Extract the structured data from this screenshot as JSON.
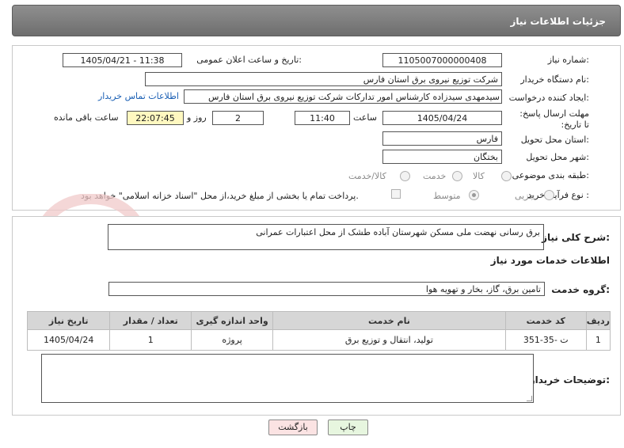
{
  "header": {
    "title": "جزئیات اطلاعات نیاز"
  },
  "form": {
    "need_number_label": "شماره نیاز:",
    "need_number": "1105007000000408",
    "announce_label": "تاریخ و ساعت اعلان عمومی:",
    "announce_value": "1405/04/21 - 11:38",
    "buyer_org_label": "نام دستگاه خریدار:",
    "buyer_org": "شرکت توزیع نیروی برق استان فارس",
    "creator_label": "ایجاد کننده درخواست:",
    "creator": "سیدمهدی سیدزاده کارشناس امور تدارکات شرکت توزیع نیروی برق استان فارس",
    "contact_link": "اطلاعات تماس خریدار",
    "deadline_label": "مهلت ارسال پاسخ: تا تاریخ:",
    "deadline_date": "1405/04/24",
    "time_label": "ساعت",
    "deadline_time": "11:40",
    "days_value": "2",
    "days_label": "روز و",
    "remaining_value": "22:07:45",
    "remaining_label": "ساعت باقی مانده",
    "province_label": "استان محل تحویل:",
    "province": "فارس",
    "city_label": "شهر محل تحویل:",
    "city": "بختگان",
    "category_label": "طبقه بندی موضوعی:",
    "category_options": {
      "goods": "کالا",
      "service": "خدمت",
      "goods_service": "کالا/خدمت"
    },
    "process_label": "نوع فرآیند خرید :",
    "process_options": {
      "partial": "جزیی",
      "medium": "متوسط"
    },
    "payment_note": "پرداخت تمام یا بخشی از مبلغ خرید،از محل \"اسناد خزانه اسلامی\" خواهد بود."
  },
  "details": {
    "general_desc_label": "شرح کلی نیاز:",
    "general_desc": "برق رسانی نهضت ملی مسکن شهرستان آباده طشک از محل اعتبارات عمرانی",
    "services_info_title": "اطلاعات خدمات مورد نیاز",
    "service_group_label": "گروه خدمت:",
    "service_group": "تامین برق، گاز، بخار و تهویه هوا",
    "table": {
      "headers": [
        "ردیف",
        "کد خدمت",
        "نام خدمت",
        "واحد اندازه گیری",
        "تعداد / مقدار",
        "تاریخ نیاز"
      ],
      "rows": [
        [
          "1",
          "ت -35-351",
          "تولید، انتقال و توزیع برق",
          "پروژه",
          "1",
          "1405/04/24"
        ]
      ]
    },
    "buyer_notes_label": "توضیحات خریدار:",
    "buyer_notes": ""
  },
  "buttons": {
    "print": "چاپ",
    "back": "بازگشت"
  },
  "watermark": {
    "text": "AriaTender.net"
  },
  "colors": {
    "header_bg": "#7a7a7a",
    "link": "#1a5fb4",
    "back_button": "#fbe3e3",
    "print_button": "#e7f6df"
  }
}
